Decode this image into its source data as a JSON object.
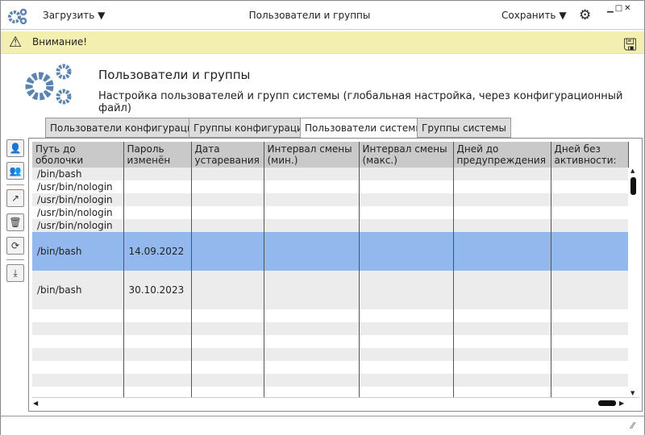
{
  "titlebar": {
    "load_label": "Загрузить",
    "title": "Пользователи и группы",
    "save_label": "Сохранить"
  },
  "warning": {
    "text": "Внимание!"
  },
  "header": {
    "title": "Пользователи и группы",
    "subtitle": "Настройка пользователей и групп системы (глобальная настройка, через конфигурационный файл)"
  },
  "tabs": [
    "Пользователи конфигурации",
    "Группы конфигурации",
    "Пользователи системы",
    "Группы системы"
  ],
  "active_tab": 2,
  "table": {
    "columns": [
      "Путь до оболочки",
      "Пароль изменён",
      "Дата устаревания",
      "Интервал смены (мин.)",
      "Интервал смены (макс.)",
      "Дней до предупреждения",
      "Дней без активности:"
    ],
    "rows": [
      [
        "/bin/bash",
        "",
        "",
        "",
        "",
        "",
        ""
      ],
      [
        "/usr/bin/nologin",
        "",
        "",
        "",
        "",
        "",
        ""
      ],
      [
        "/usr/bin/nologin",
        "",
        "",
        "",
        "",
        "",
        ""
      ],
      [
        "/usr/bin/nologin",
        "",
        "",
        "",
        "",
        "",
        ""
      ],
      [
        "/usr/bin/nologin",
        "",
        "",
        "",
        "",
        "",
        ""
      ],
      [
        "/bin/bash",
        "14.09.2022",
        "",
        "",
        "",
        "",
        ""
      ],
      [
        "/bin/bash",
        "30.10.2023",
        "",
        "",
        "",
        "",
        ""
      ]
    ]
  },
  "colors": {
    "accent": "#5b84b1",
    "selected_row": "#93b8ee",
    "warning_bg": "#f3efb0"
  }
}
